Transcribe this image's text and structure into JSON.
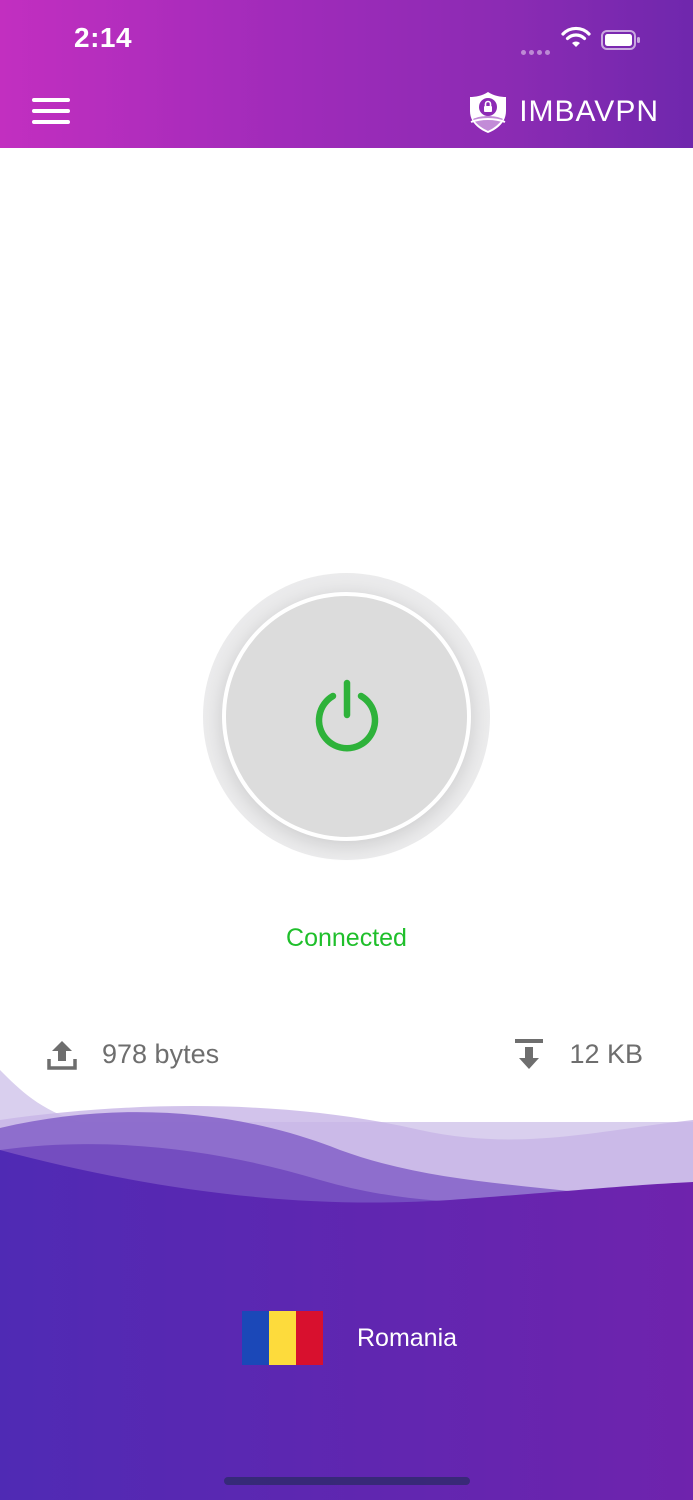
{
  "status_bar": {
    "time": "2:14"
  },
  "header": {
    "brand_name": "IMBAVPN",
    "menu_icon": "hamburger-menu-icon",
    "logo_icon": "shield-lock-icon",
    "gradient_start": "#c22fc0",
    "gradient_end": "#6f27ad"
  },
  "connection": {
    "status": "Connected",
    "status_color": "#1fbf2b",
    "power_icon": "power-icon"
  },
  "traffic": {
    "upload_icon": "upload-icon",
    "upload": "978 bytes",
    "download_icon": "download-icon",
    "download": "12 KB"
  },
  "location": {
    "country": "Romania",
    "flag_icon": "romania-flag-icon",
    "flag_colors": [
      "#1b48b8",
      "#fddb3c",
      "#d8102e"
    ]
  }
}
